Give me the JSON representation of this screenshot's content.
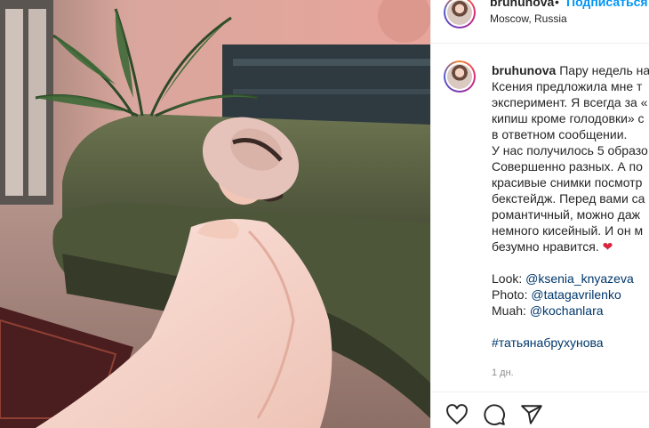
{
  "post": {
    "username": "bruhunova",
    "separator": "•",
    "follow_label": "Подписаться",
    "location": "Moscow, Russia"
  },
  "caption": {
    "username": "bruhunova",
    "lines": [
      "Пару недель на",
      "Ксения предложила мне т",
      "эксперимент. Я всегда за «",
      "кипиш кроме голодовки» с",
      "в ответном сообщении.",
      "У нас получилось 5 образо",
      "Совершенно разных. А по",
      "красивые снимки посмотр",
      "бекстейдж. Перед вами са",
      "романтичный, можно даж",
      "немного кисейный. И он м",
      "безумно нравится."
    ],
    "heart_emoji": "❤",
    "credits": [
      {
        "label": "Look:",
        "mention": "@ksenia_knyazeva"
      },
      {
        "label": "Photo:",
        "mention": "@tatagavrilenko"
      },
      {
        "label": "Muah:",
        "mention": "@kochanlara"
      }
    ],
    "hashtag": "#татьянабрухунова",
    "time": "1 дн."
  },
  "actions": {
    "icons": [
      "heart-icon",
      "comment-icon",
      "share-icon"
    ]
  },
  "colors": {
    "link_blue": "#0095f6",
    "mention": "#00376b",
    "text": "#262626",
    "muted": "#8e8e8e"
  }
}
